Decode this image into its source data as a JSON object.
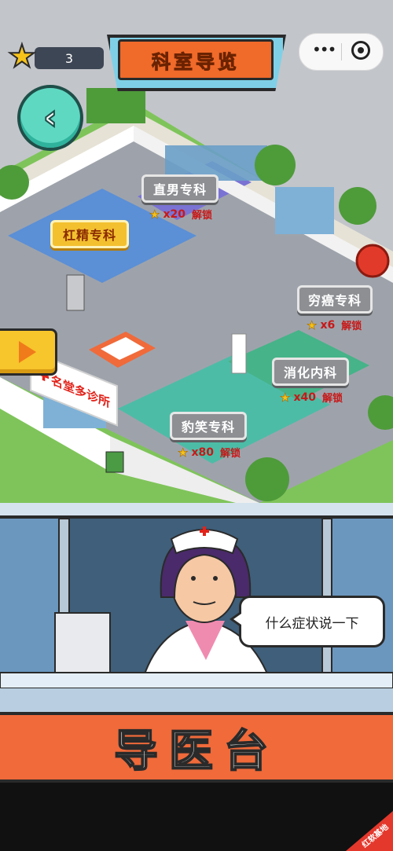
{
  "hud": {
    "star_count": "3",
    "title": "科室导览"
  },
  "departments": [
    {
      "id": "zhinan",
      "label": "直男专科",
      "locked": true,
      "cost": "x20",
      "action": "解锁"
    },
    {
      "id": "gangjing",
      "label": "杠精专科",
      "locked": false
    },
    {
      "id": "qiongai",
      "label": "穷癌专科",
      "locked": true,
      "cost": "x6",
      "action": "解锁"
    },
    {
      "id": "xiaohua",
      "label": "消化内科",
      "locked": true,
      "cost": "x40",
      "action": "解锁"
    },
    {
      "id": "baoxiao",
      "label": "豹笑专科",
      "locked": true,
      "cost": "x80",
      "action": "解锁"
    }
  ],
  "signboard": "名堂多诊所",
  "reception": {
    "speech": "什么症状说一下",
    "banner": "导医台"
  },
  "watermark": "红软基地",
  "colors": {
    "accent_orange": "#f06a3a",
    "locked_gray": "#8d8f93",
    "open_yellow": "#f3c030",
    "cost_red": "#c81818",
    "teal": "#5fd8c2"
  }
}
